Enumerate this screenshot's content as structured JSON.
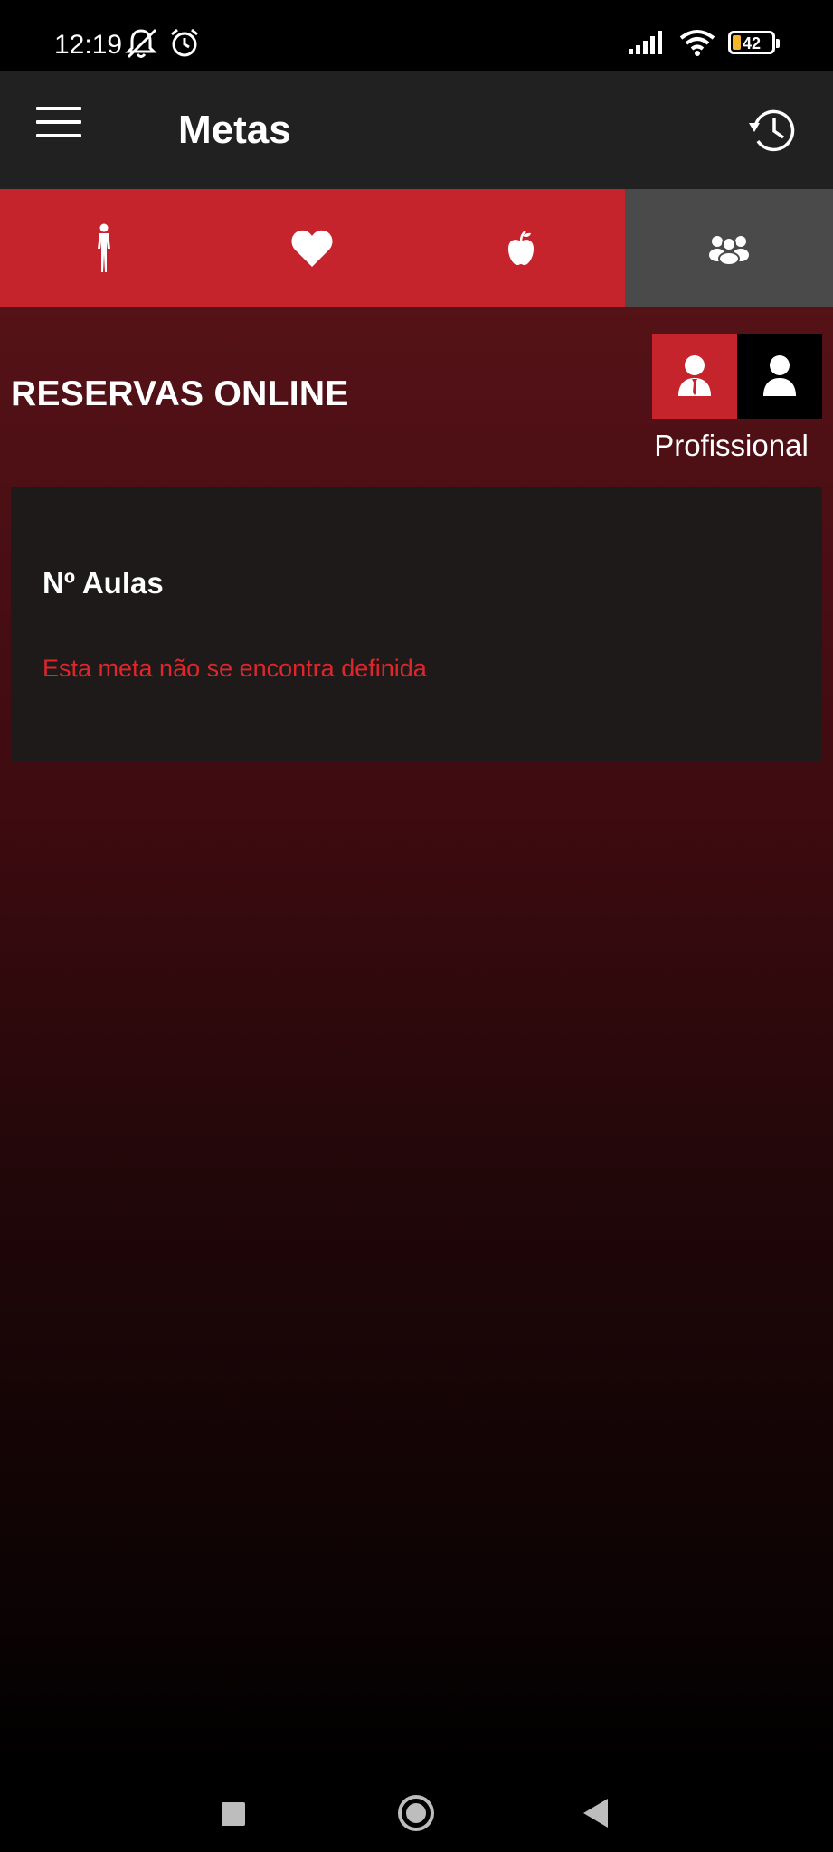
{
  "status_bar": {
    "time": "12:19",
    "battery_level": "42",
    "icons": [
      "bell-off-icon",
      "alarm-icon",
      "signal-icon",
      "wifi-icon",
      "battery-icon"
    ]
  },
  "app_bar": {
    "title": "Metas",
    "menu_icon": "menu-icon",
    "history_icon": "history-icon"
  },
  "tabs": [
    {
      "icon": "body-icon",
      "active": false
    },
    {
      "icon": "heart-icon",
      "active": false
    },
    {
      "icon": "apple-icon",
      "active": false
    },
    {
      "icon": "group-icon",
      "active": true
    }
  ],
  "section": {
    "title": "RESERVAS ONLINE",
    "role_label": "Profissional"
  },
  "card": {
    "title": "Nº Aulas",
    "message": "Esta meta não se encontra definida"
  },
  "colors": {
    "accent_red": "#c5242c",
    "error_red": "#e0252b",
    "appbar": "#212121",
    "active_tab": "#4a4a4a",
    "card_bg": "#1e1a1a"
  }
}
